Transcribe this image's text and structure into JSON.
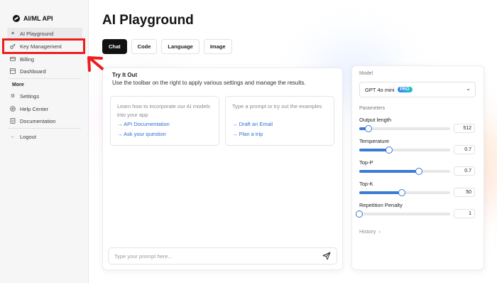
{
  "sidebar": {
    "brand": "AI/ML API",
    "items": [
      {
        "label": "AI Playground"
      },
      {
        "label": "Key Management"
      },
      {
        "label": "Billing"
      },
      {
        "label": "Dashboard"
      }
    ],
    "more_section": "More",
    "more_items": [
      {
        "label": "Settings"
      },
      {
        "label": "Help Center"
      },
      {
        "label": "Documentation"
      }
    ],
    "logout": "Logout"
  },
  "header": {
    "title": "AI Playground",
    "tabs": [
      {
        "label": "Chat",
        "active": true
      },
      {
        "label": "Code"
      },
      {
        "label": "Language"
      },
      {
        "label": "Image"
      }
    ]
  },
  "chat": {
    "try_title": "Try It Out",
    "try_desc": "Use the toolbar on the right to apply various settings and manage the results.",
    "cards": [
      {
        "text": "Learn how to incorporate our AI models into your app",
        "links": [
          "→ API Documentation",
          "→ Ask your question"
        ]
      },
      {
        "text": "Type a prompt or try out the examples",
        "links": [
          "→ Draft an Email",
          "→ Plan a trip"
        ]
      }
    ],
    "prompt_placeholder": "Type your prompt here..."
  },
  "settings": {
    "model_label": "Model",
    "model_value": "GPT 4o mini",
    "model_badge": "PRO",
    "params_label": "Parameters",
    "params": [
      {
        "label": "Output length",
        "value": "512",
        "fraction": 0.1
      },
      {
        "label": "Temperature",
        "value": "0.7",
        "fraction": 0.33
      },
      {
        "label": "Top-P",
        "value": "0.7",
        "fraction": 0.66
      },
      {
        "label": "Top-K",
        "value": "50",
        "fraction": 0.47
      },
      {
        "label": "Repetition Penalty",
        "value": "1",
        "fraction": 0.0
      }
    ],
    "history_label": "History"
  },
  "colors": {
    "accent": "#3a7bd5",
    "annotation": "#ef1c1c",
    "link": "#2f6fd1"
  }
}
